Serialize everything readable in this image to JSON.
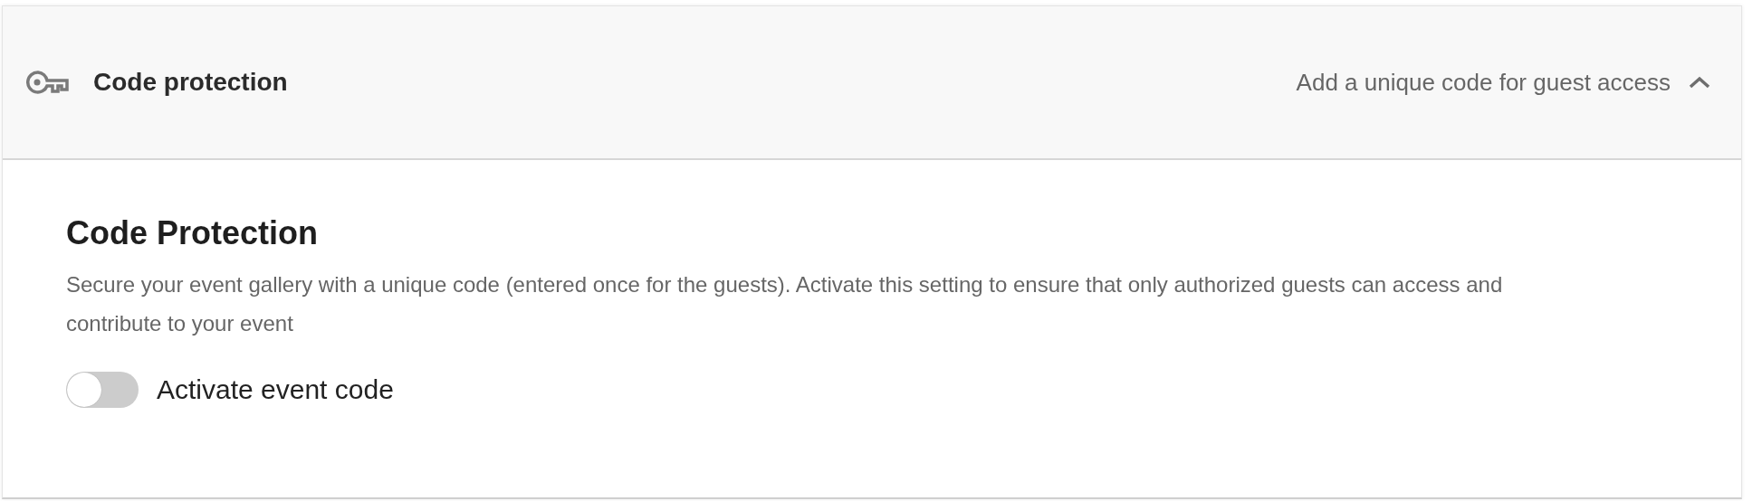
{
  "section": {
    "title": "Code protection",
    "summary": "Add a unique code for guest access",
    "expanded": true
  },
  "panel": {
    "heading": "Code Protection",
    "description": "Secure your event gallery with a unique code (entered once for the guests). Activate this setting to ensure that only authorized guests can access and contribute to your event",
    "toggle": {
      "label": "Activate event code",
      "on": false
    }
  }
}
